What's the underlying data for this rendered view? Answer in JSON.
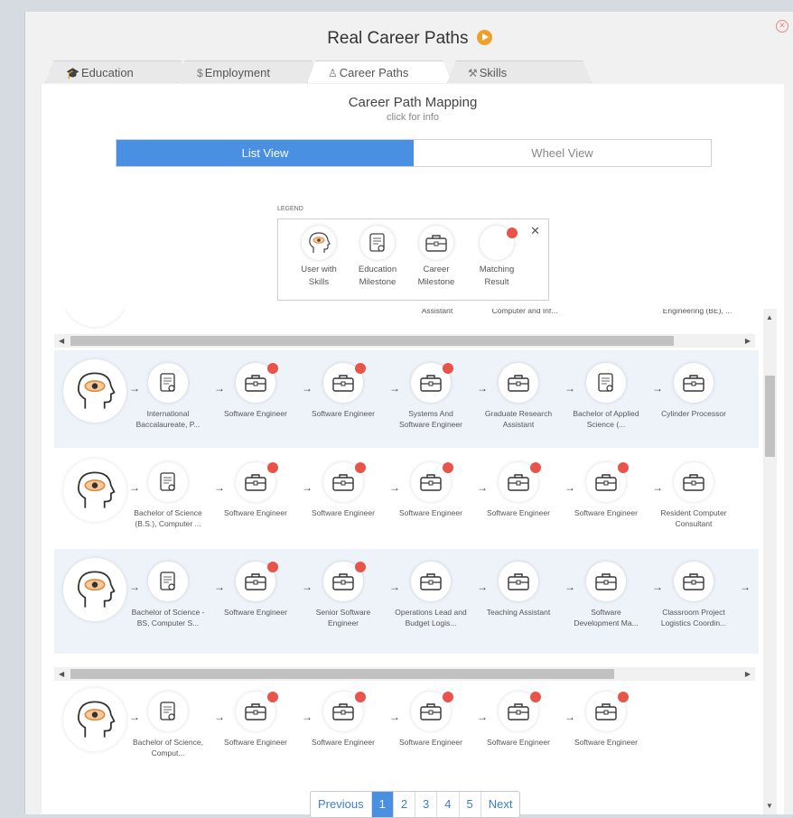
{
  "window": {
    "title": "Real Career Paths"
  },
  "tabs": [
    {
      "label": "Education",
      "icon": "graduation-cap-icon"
    },
    {
      "label": "Employment",
      "icon": "dollar-icon"
    },
    {
      "label": "Career Paths",
      "icon": "user-icon"
    },
    {
      "label": "Skills",
      "icon": "wrench-icon"
    }
  ],
  "mapping": {
    "title": "Career Path Mapping",
    "subtitle": "click for info"
  },
  "view_toggle": {
    "list": "List View",
    "wheel": "Wheel View",
    "selected": "List View"
  },
  "legend": {
    "label": "LEGEND",
    "items": [
      {
        "label": "User with Skills",
        "icon": "head-eye-icon"
      },
      {
        "label": "Education Milestone",
        "icon": "certificate-icon"
      },
      {
        "label": "Career Milestone",
        "icon": "briefcase-icon"
      },
      {
        "label": "Matching Result",
        "icon": "red-dot-icon"
      }
    ]
  },
  "partial_top": [
    "Assistant",
    "Computer and Inf...",
    "Engineering (BE), ..."
  ],
  "paths": [
    {
      "milestones": [
        {
          "type": "education",
          "label": "International Baccalaureate, P...",
          "match": false
        },
        {
          "type": "career",
          "label": "Software Engineer",
          "match": true
        },
        {
          "type": "career",
          "label": "Software Engineer",
          "match": true
        },
        {
          "type": "career",
          "label": "Systems And Software Engineer",
          "match": true
        },
        {
          "type": "career",
          "label": "Graduate Research Assistant",
          "match": false
        },
        {
          "type": "education",
          "label": "Bachelor of Applied Science (...",
          "match": false
        },
        {
          "type": "career",
          "label": "Cylinder Processor",
          "match": false
        }
      ]
    },
    {
      "milestones": [
        {
          "type": "education",
          "label": "Bachelor of Science (B.S.), Computer ...",
          "match": false
        },
        {
          "type": "career",
          "label": "Software Engineer",
          "match": true
        },
        {
          "type": "career",
          "label": "Software Engineer",
          "match": true
        },
        {
          "type": "career",
          "label": "Software Engineer",
          "match": true
        },
        {
          "type": "career",
          "label": "Software Engineer",
          "match": true
        },
        {
          "type": "career",
          "label": "Software Engineer",
          "match": true
        },
        {
          "type": "career",
          "label": "Resident Computer Consultant",
          "match": false
        }
      ]
    },
    {
      "milestones": [
        {
          "type": "education",
          "label": "Bachelor of Science - BS, Computer S...",
          "match": false
        },
        {
          "type": "career",
          "label": "Software Engineer",
          "match": true
        },
        {
          "type": "career",
          "label": "Senior Software Engineer",
          "match": true
        },
        {
          "type": "career",
          "label": "Operations Lead and Budget Logis...",
          "match": false
        },
        {
          "type": "career",
          "label": "Teaching Assistant",
          "match": false
        },
        {
          "type": "career",
          "label": "Software Development Ma...",
          "match": false
        },
        {
          "type": "career",
          "label": "Classroom Project Logistics Coordin...",
          "match": false
        }
      ]
    },
    {
      "milestones": [
        {
          "type": "education",
          "label": "Bachelor of Science, Comput...",
          "match": false
        },
        {
          "type": "career",
          "label": "Software Engineer",
          "match": true
        },
        {
          "type": "career",
          "label": "Software Engineer",
          "match": true
        },
        {
          "type": "career",
          "label": "Software Engineer",
          "match": true
        },
        {
          "type": "career",
          "label": "Software Engineer",
          "match": true
        },
        {
          "type": "career",
          "label": "Software Engineer",
          "match": true
        }
      ]
    }
  ],
  "pagination": {
    "previous": "Previous",
    "pages": [
      "1",
      "2",
      "3",
      "4",
      "5"
    ],
    "current": "1",
    "next": "Next"
  },
  "colors": {
    "accent": "#4a90e2",
    "match_dot": "#e8544a",
    "play": "#f0a02a"
  }
}
